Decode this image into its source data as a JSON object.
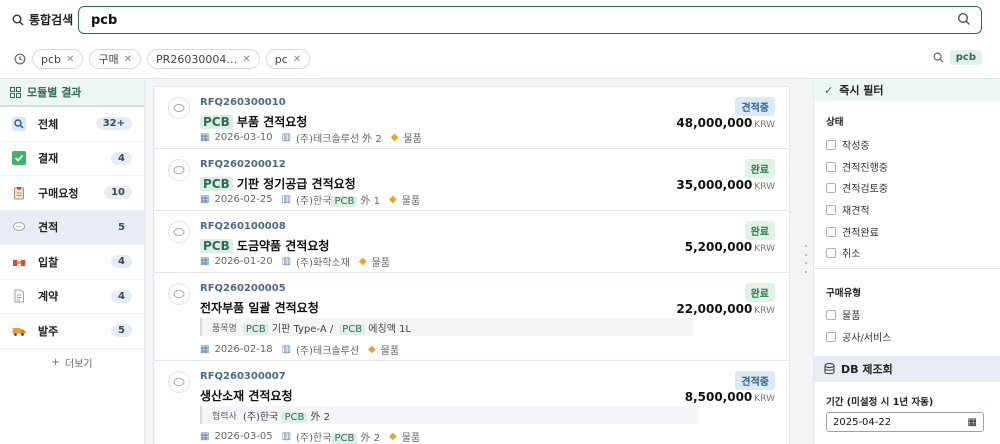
{
  "search": {
    "label": "통합검색",
    "value": "pcb",
    "recent": [
      "pcb",
      "구매",
      "PR26030004…",
      "pc"
    ],
    "right_tag": "pcb"
  },
  "modules": {
    "header": "모듈별 결과",
    "items": [
      {
        "label": "전체",
        "count": "32+",
        "icon": "search-icon"
      },
      {
        "label": "결재",
        "count": "4",
        "icon": "check-icon"
      },
      {
        "label": "구매요청",
        "count": "10",
        "icon": "clipboard-icon"
      },
      {
        "label": "견적",
        "count": "5",
        "icon": "chat-bubble-icon"
      },
      {
        "label": "입찰",
        "count": "4",
        "icon": "bid-icon"
      },
      {
        "label": "계약",
        "count": "4",
        "icon": "document-icon"
      },
      {
        "label": "발주",
        "count": "5",
        "icon": "truck-icon"
      }
    ],
    "more": "더보기"
  },
  "results": [
    {
      "id": "RFQ260300010",
      "title_hl": "PCB",
      "title_rest": " 부품 견적요청",
      "date": "2026-03-10",
      "company_pre": "(주)테크솔루션 外 2",
      "company_hl": "",
      "company_post": "",
      "type": "물품",
      "status": "견적중",
      "status_color": "blue",
      "amount": "48,000,000",
      "currency": "KRW"
    },
    {
      "id": "RFQ260200012",
      "title_hl": "PCB",
      "title_rest": " 기판 정기공급 견적요청",
      "date": "2026-02-25",
      "company_pre": "(주)한국",
      "company_hl": "PCB",
      "company_post": " 外 1",
      "type": "물품",
      "status": "완료",
      "status_color": "green",
      "amount": "35,000,000",
      "currency": "KRW"
    },
    {
      "id": "RFQ260100008",
      "title_hl": "PCB",
      "title_rest": " 도금약품 견적요청",
      "date": "2026-01-20",
      "company_pre": "(주)화학소재",
      "company_hl": "",
      "company_post": "",
      "type": "물품",
      "status": "완료",
      "status_color": "green",
      "amount": "5,200,000",
      "currency": "KRW"
    },
    {
      "id": "RFQ260200005",
      "title_hl": "",
      "title_rest": "전자부품 일괄 견적요청",
      "detail_key": "품목명",
      "detail_a_hl": "PCB",
      "detail_a": " 기판 Type-A /",
      "detail_b_hl": "PCB",
      "detail_b": " 에칭액 1L",
      "date": "2026-02-18",
      "company_pre": "(주)테크솔루션",
      "company_hl": "",
      "company_post": "",
      "type": "물품",
      "status": "완료",
      "status_color": "green",
      "amount": "22,000,000",
      "currency": "KRW"
    },
    {
      "id": "RFQ260300007",
      "title_hl": "",
      "title_rest": "생산소재 견적요청",
      "detail_key": "협력사",
      "detail_a_pre": "(주)한국",
      "detail_a_hl": "PCB",
      "detail_a": " 外 2",
      "date": "2026-03-05",
      "company_pre": "(주)한국",
      "company_hl": "PCB",
      "company_post": " 外 2",
      "type": "물품",
      "status": "견적중",
      "status_color": "blue",
      "amount": "8,500,000",
      "currency": "KRW"
    }
  ],
  "filters": {
    "header": "즉시 필터",
    "status_title": "상태",
    "status_options": [
      "작성중",
      "견적진행중",
      "견적검토중",
      "재견적",
      "견적완료",
      "취소"
    ],
    "type_title": "구매유형",
    "type_options": [
      "물품",
      "공사/서비스"
    ],
    "db_header": "DB 제조회",
    "period_label": "기간 (미설정 시 1년 자동)",
    "period_value": "2025-04-22"
  }
}
